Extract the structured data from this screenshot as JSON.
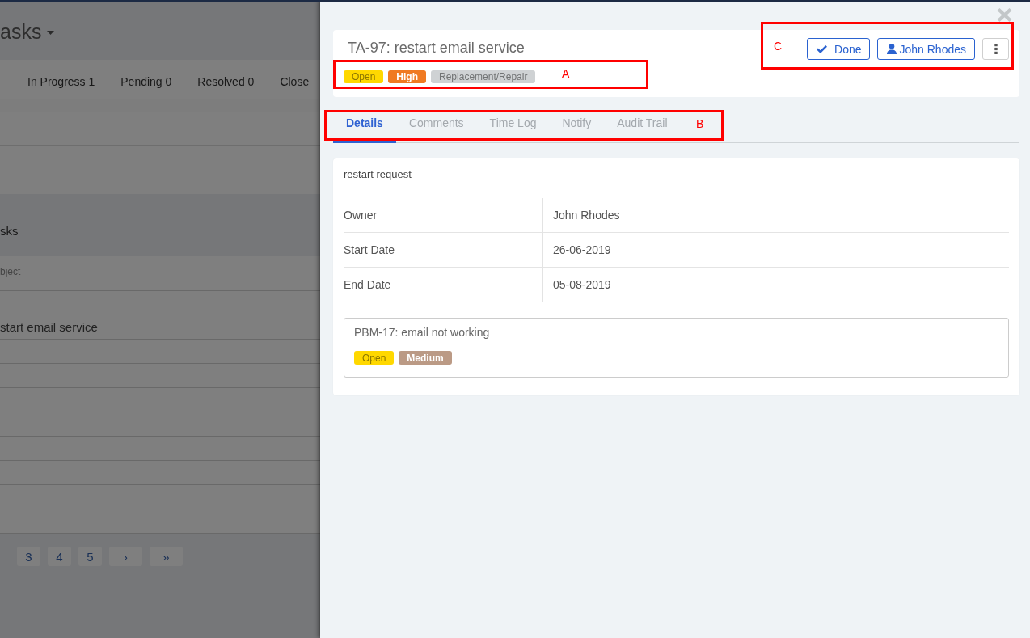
{
  "background_page": {
    "title": "asks",
    "status_tabs": [
      {
        "label": "In Progress 1"
      },
      {
        "label": "Pending 0"
      },
      {
        "label": "Resolved 0"
      },
      {
        "label": "Close"
      }
    ],
    "list_title": "sks",
    "table": {
      "columns": [
        "bject"
      ],
      "rows": [
        {},
        {
          "cells": [
            "start email service"
          ]
        },
        {},
        {},
        {},
        {},
        {},
        {},
        {},
        {}
      ]
    },
    "pagination": [
      {
        "label": "3",
        "kind": "page"
      },
      {
        "label": "4",
        "kind": "page"
      },
      {
        "label": "5",
        "kind": "page"
      },
      {
        "label": "›",
        "kind": "arrow"
      },
      {
        "label": "»",
        "kind": "arrow"
      }
    ]
  },
  "panel": {
    "title": "TA-97: restart email service",
    "tags": [
      {
        "label": "Open",
        "color": "#ffd800"
      },
      {
        "label": "High",
        "color": "#f07a22"
      },
      {
        "label": "Replacement/Repair",
        "color": "#cfd2d4"
      }
    ],
    "tags_annotation": {
      "label": "A"
    },
    "buttons": [
      {
        "label": "Done",
        "kind": "done"
      },
      {
        "label": "John Rhodes",
        "kind": "assignee"
      },
      {
        "kind": "more"
      }
    ],
    "actions_annotation": {
      "label": "C"
    },
    "tabs": [
      {
        "label": "Details",
        "selected": true
      },
      {
        "label": "Comments",
        "selected": false
      },
      {
        "label": "Time Log",
        "selected": false
      },
      {
        "label": "Notify",
        "selected": false
      },
      {
        "label": "Audit Trail",
        "selected": false
      }
    ],
    "tabs_annotation": {
      "label": "B"
    },
    "details": {
      "description": "restart request",
      "fields": [
        {
          "label": "Owner",
          "value": "John Rhodes"
        },
        {
          "label": "Start Date",
          "value": "26-06-2019"
        },
        {
          "label": "End Date",
          "value": "05-08-2019"
        }
      ],
      "linked_issue": {
        "title": "PBM-17: email not working",
        "tags": [
          {
            "label": "Open",
            "color": "#ffd800"
          },
          {
            "label": "Medium",
            "color": "#bb9a85"
          }
        ]
      }
    }
  }
}
